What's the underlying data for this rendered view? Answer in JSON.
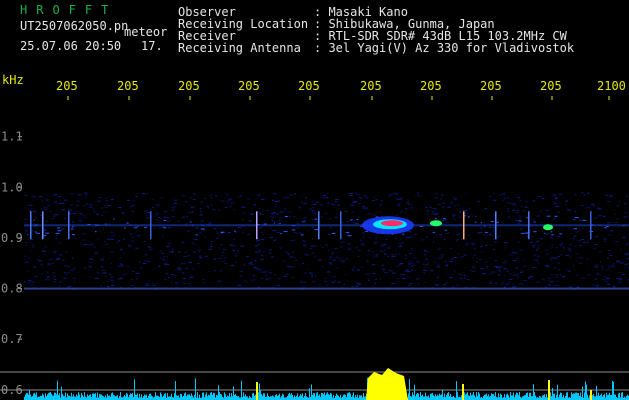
{
  "app": {
    "title": "HROFFT",
    "filename": "UT2507062050.pn",
    "tag": "meteor",
    "datetime": "25.07.06 20:50",
    "count": "17."
  },
  "info": [
    {
      "label": "Observer",
      "value": ": Masaki Kano"
    },
    {
      "label": "Receiving Location",
      "value": ": Shibukawa, Gunma, Japan"
    },
    {
      "label": "Receiver",
      "value": ": RTL-SDR SDR# 43dB L15 103.2MHz CW"
    },
    {
      "label": "Receiving Antenna",
      "value": ": 3el Yagi(V) Az 330 for Vladivostok"
    }
  ],
  "chart_data": {
    "type": "heatmap",
    "xlabel": "",
    "ylabel": "kHz",
    "x_tick_labels": [
      "205",
      "205",
      "205",
      "205",
      "205",
      "205",
      "205",
      "205",
      "205",
      "2100"
    ],
    "y_tick_labels": [
      "1.1",
      "1.0",
      "0.9",
      "0.8",
      "0.7",
      "0.6"
    ],
    "y_ticks": [
      1.1,
      1.0,
      0.9,
      0.8,
      0.7,
      0.6
    ],
    "ylim": [
      0.58,
      1.2
    ],
    "signal_band_khz": [
      0.8,
      0.99
    ],
    "carrier_khz": 0.925,
    "meteor_echo_khz": 0.925,
    "colors": {
      "background": "#000000",
      "axis_text": "#e8e800",
      "tick_labels": "#8c8c8c",
      "header_text": "#e6e6e6",
      "title": "#18b04a",
      "level_bar": "#00c8ff",
      "level_peak": "#ffff00"
    }
  }
}
